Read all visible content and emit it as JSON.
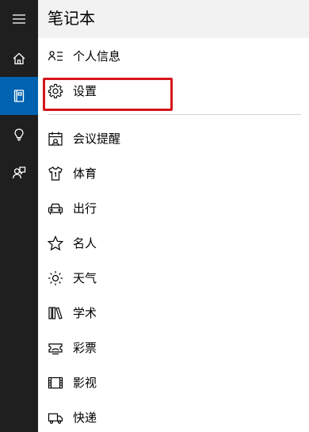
{
  "rail": {
    "items": [
      {
        "icon": "hamburger-menu-icon"
      },
      {
        "icon": "home-icon"
      },
      {
        "icon": "notebook-icon",
        "active": true
      },
      {
        "icon": "lightbulb-icon"
      },
      {
        "icon": "feedback-icon"
      }
    ]
  },
  "header": {
    "title": "笔记本"
  },
  "menu": {
    "items": [
      {
        "label": "个人信息",
        "icon": "person-list-icon"
      },
      {
        "label": "设置",
        "icon": "gear-icon"
      },
      {
        "label": "会议提醒",
        "icon": "calendar-icon"
      },
      {
        "label": "体育",
        "icon": "jersey-icon"
      },
      {
        "label": "出行",
        "icon": "car-icon"
      },
      {
        "label": "名人",
        "icon": "star-icon"
      },
      {
        "label": "天气",
        "icon": "sun-icon"
      },
      {
        "label": "学术",
        "icon": "books-icon"
      },
      {
        "label": "彩票",
        "icon": "lottery-icon"
      },
      {
        "label": "影视",
        "icon": "film-icon"
      },
      {
        "label": "快递",
        "icon": "truck-icon"
      }
    ]
  },
  "colors": {
    "accent": "#0063b1",
    "rail_bg": "#1f1f1f",
    "header_bg": "#f2f2f2",
    "highlight": "#d4141b"
  }
}
